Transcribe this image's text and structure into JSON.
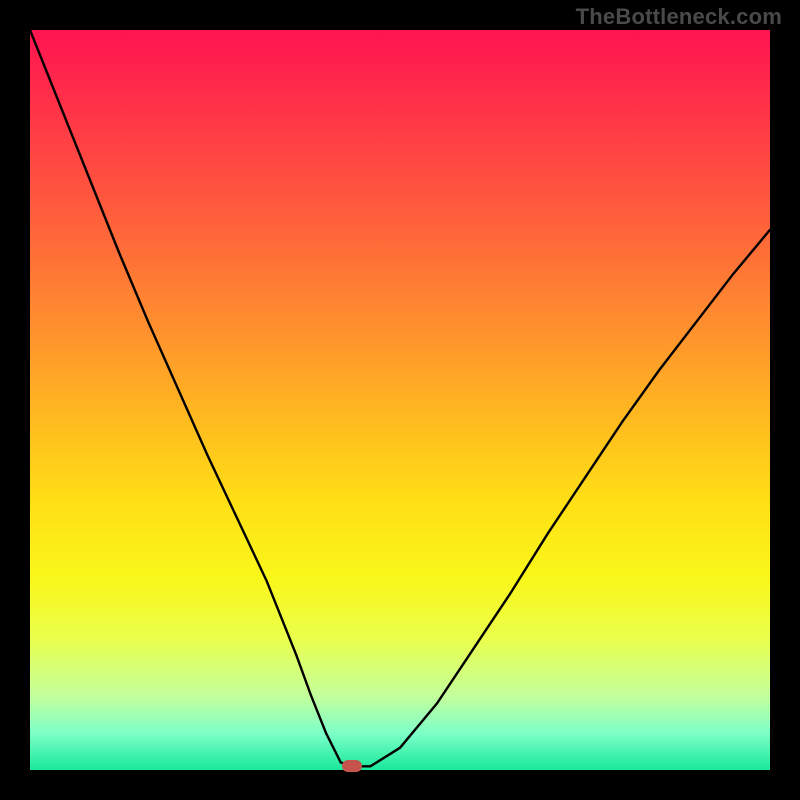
{
  "watermark": "TheBottleneck.com",
  "chart_data": {
    "type": "line",
    "title": "",
    "xlabel": "",
    "ylabel": "",
    "xlim": [
      0,
      100
    ],
    "ylim": [
      0,
      100
    ],
    "grid": false,
    "legend": false,
    "series": [
      {
        "name": "bottleneck-curve",
        "x": [
          0,
          4,
          8,
          12,
          16,
          20,
          24,
          28,
          32,
          36,
          38,
          40,
          42,
          44,
          46,
          50,
          55,
          60,
          65,
          70,
          75,
          80,
          85,
          90,
          95,
          100
        ],
        "y": [
          100,
          90,
          80,
          70,
          60.5,
          51.5,
          42.5,
          34,
          25.5,
          15.5,
          10,
          5,
          1,
          0.5,
          0.5,
          3,
          9,
          16.5,
          24,
          32,
          39.5,
          47,
          54,
          60.5,
          67,
          73
        ]
      }
    ],
    "marker": {
      "x": 43.5,
      "y": 0.5
    },
    "colors": {
      "curve": "#000000",
      "marker": "#c5544d",
      "gradient_top": "#ff1450",
      "gradient_mid": "#ffe015",
      "gradient_bottom": "#18e89a",
      "frame": "#000000"
    }
  }
}
